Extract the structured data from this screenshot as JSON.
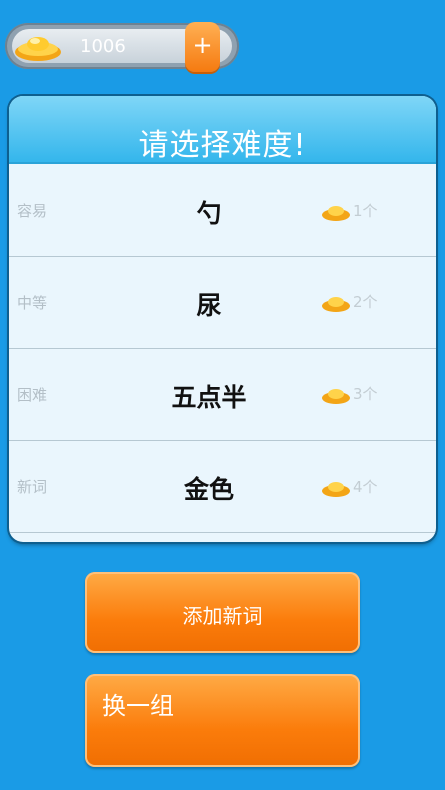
{
  "wallet": {
    "coins": "1006",
    "add_label": "+"
  },
  "panel": {
    "title": "请选择难度!",
    "rows": [
      {
        "level": "容易",
        "word": "勺",
        "cost": "1个"
      },
      {
        "level": "中等",
        "word": "尿",
        "cost": "2个"
      },
      {
        "level": "困难",
        "word": "五点半",
        "cost": "3个"
      },
      {
        "level": "新词",
        "word": "金色",
        "cost": "4个"
      }
    ]
  },
  "actions": {
    "add_word": "添加新词",
    "swap_group": "换一组"
  },
  "colors": {
    "background": "#1a9be6",
    "accent": "#fb7c0b",
    "header": "#34b6ec"
  },
  "icons": {
    "coin": "gold-ingot-icon",
    "plus": "plus-icon"
  }
}
